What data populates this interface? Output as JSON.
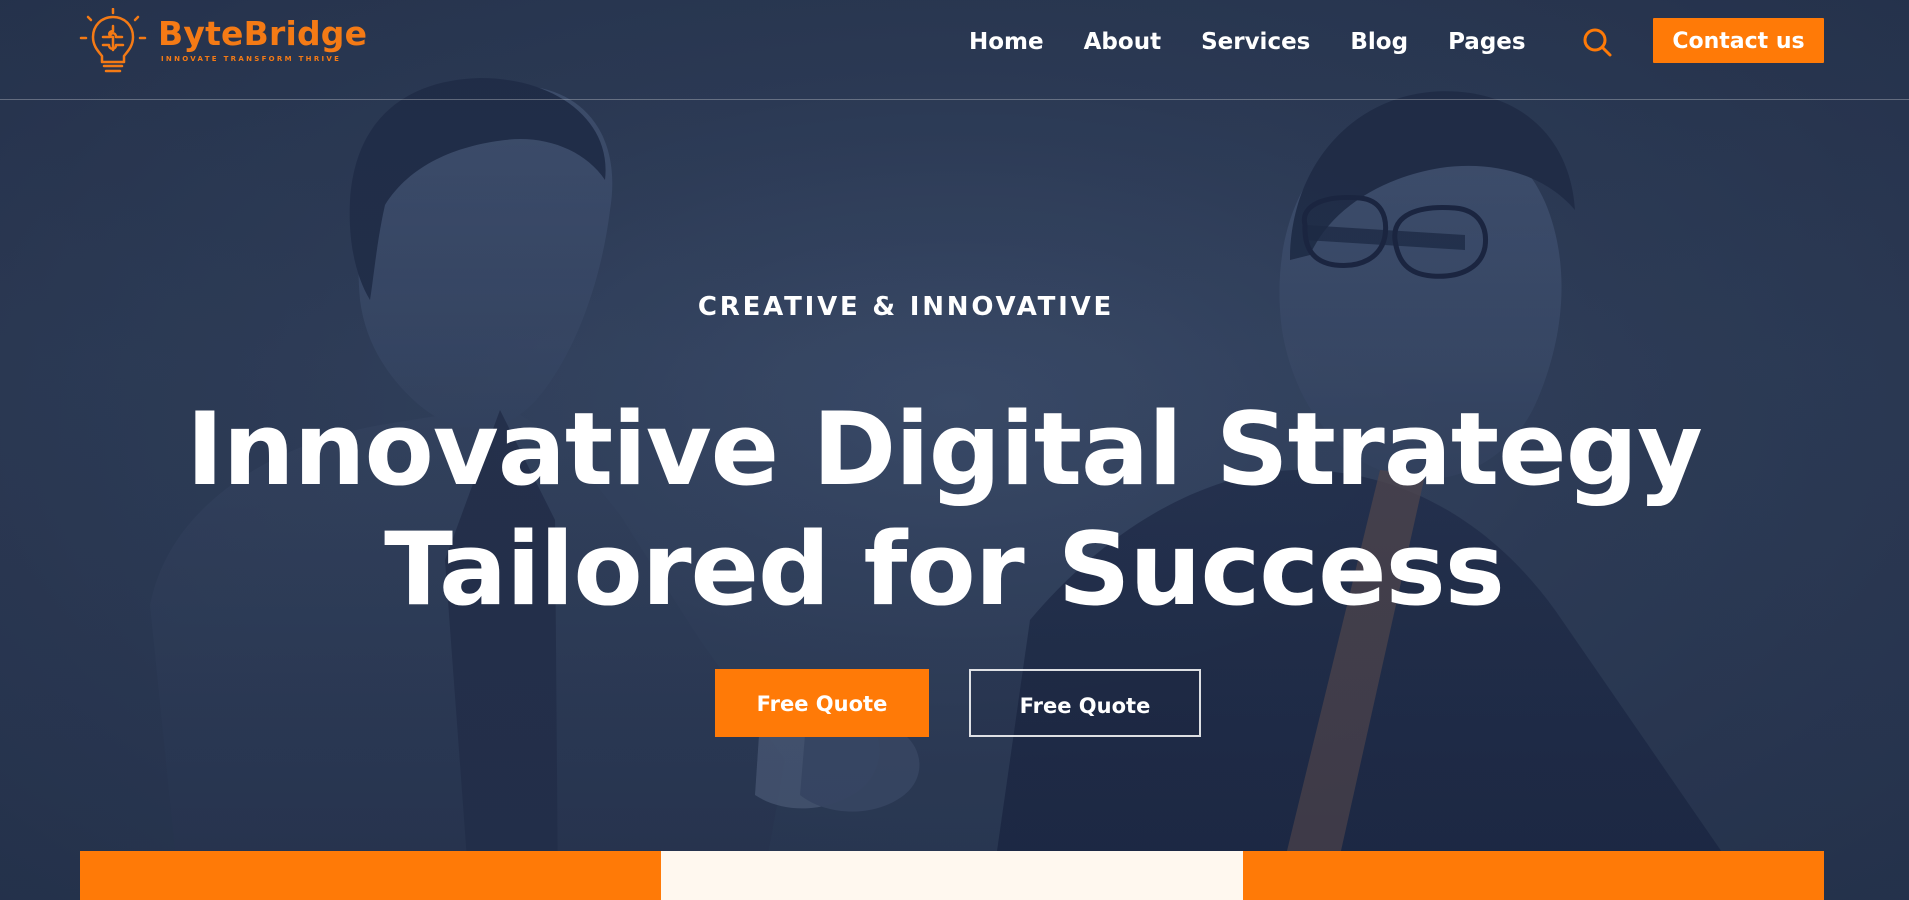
{
  "brand": {
    "name": "ByteBridge",
    "tagline": "INNOVATE   TRANSFORM   THRIVE",
    "logo_icon": "bulb-puzzle-icon",
    "accent_color": "#f47a15"
  },
  "navigation": {
    "items": [
      {
        "label": "Home"
      },
      {
        "label": "About"
      },
      {
        "label": "Services"
      },
      {
        "label": "Blog"
      },
      {
        "label": "Pages"
      }
    ],
    "search_icon": "search-icon",
    "contact_label": "Contact us"
  },
  "hero": {
    "eyebrow": "CREATIVE & INNOVATIVE",
    "headline_line1": "Innovative Digital Strategy",
    "headline_line2": "Tailored for Success",
    "primary_cta": "Free Quote",
    "secondary_cta": "Free Quote"
  },
  "colors": {
    "background_overlay": "#34425d",
    "button_orange": "#ff7a07",
    "cream": "#fff8ef",
    "white": "#ffffff"
  }
}
